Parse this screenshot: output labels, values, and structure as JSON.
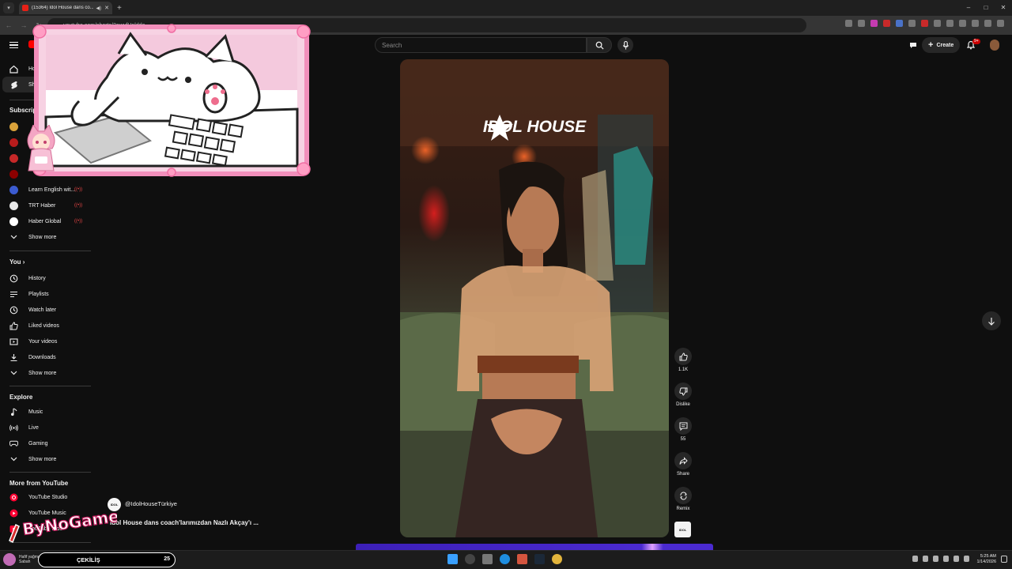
{
  "browser": {
    "tab_title": "(15364) Idol House dans co...",
    "url": "youtube.com/shorts/2owyfUnlddo",
    "window_controls": [
      "–",
      "□",
      "✕"
    ]
  },
  "masthead": {
    "search_placeholder": "Search",
    "create_label": "Create",
    "notification_badge": "9+"
  },
  "sidebar": {
    "nav": [
      {
        "label": "Home",
        "icon": "home-icon"
      },
      {
        "label": "Shorts",
        "icon": "shorts-icon"
      }
    ],
    "subscriptions_heading": "Subscriptions",
    "subscriptions": [
      {
        "label": "Learn English wit...",
        "color": "#3b5bd0",
        "live": "((•))"
      },
      {
        "label": "TRT Haber",
        "color": "#c62828",
        "live": "((•))"
      },
      {
        "label": "Haber Global",
        "color": "#ffffff",
        "live": "((•))"
      }
    ],
    "subs_show_more": "Show more",
    "you_heading": "You",
    "you_items": [
      {
        "label": "History",
        "icon": "history-icon"
      },
      {
        "label": "Playlists",
        "icon": "playlists-icon"
      },
      {
        "label": "Watch later",
        "icon": "watch-later-icon"
      },
      {
        "label": "Liked videos",
        "icon": "like-icon"
      },
      {
        "label": "Your videos",
        "icon": "your-videos-icon"
      },
      {
        "label": "Downloads",
        "icon": "download-icon"
      },
      {
        "label": "Show more",
        "icon": "chevron-down-icon"
      }
    ],
    "explore_heading": "Explore",
    "explore_items": [
      {
        "label": "Music",
        "icon": "music-icon"
      },
      {
        "label": "Live",
        "icon": "live-icon"
      },
      {
        "label": "Gaming",
        "icon": "gaming-icon"
      },
      {
        "label": "Show more",
        "icon": "chevron-down-icon"
      }
    ],
    "more_heading": "More from YouTube",
    "more_items": [
      {
        "label": "YouTube Studio"
      },
      {
        "label": "YouTube Music"
      },
      {
        "label": "YouTube Kids"
      }
    ]
  },
  "video": {
    "brand_overlay": "IDOL HOUSE",
    "channel_handle": "@IdolHouseTürkiye",
    "channel_avatar_text": "IDOL",
    "title": "Idol House dans coach'larımızdan Nazlı Akçay'ı ...",
    "actions": {
      "like_count": "1.1K",
      "dislike_label": "Dislike",
      "comment_count": "55",
      "share_label": "Share",
      "remix_label": "Remix"
    },
    "sound_thumb_text": "IDOL"
  },
  "overlay": {
    "bynogame_text": "ByNoGame"
  },
  "taskbar": {
    "weather_line1": "Hafif yağmur",
    "weather_line2": "Sabah",
    "giveaway_label": "ÇEKİLİŞ",
    "giveaway_count": "25",
    "time": "5:25 AM",
    "date": "1/14/2026"
  },
  "colors": {
    "background": "#0f0f0f",
    "accent_red": "#ff0000",
    "overlay_pink": "#f6c6dc",
    "purple_bar": "#4a2ad0"
  }
}
